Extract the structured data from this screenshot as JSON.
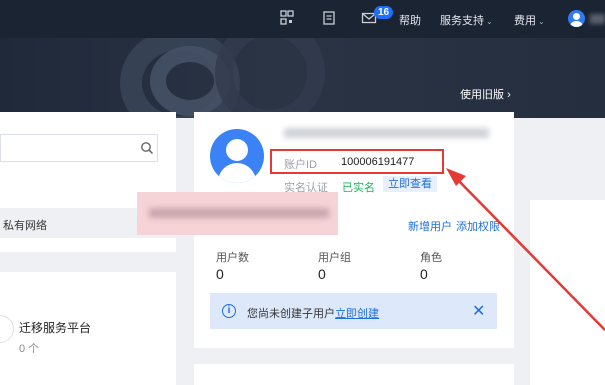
{
  "topbar": {
    "message_badge": "16",
    "help": "帮助",
    "service_support": "服务支持",
    "billing": "费用",
    "icons": [
      "qrcode-icon",
      "document-icon",
      "mail-icon",
      "user-avatar-icon"
    ]
  },
  "hero": {
    "old_version_link": "使用旧版"
  },
  "left_panel": {
    "network_item": "私有网络",
    "migration_title": "迁移服务平台",
    "migration_count": "0 个"
  },
  "account": {
    "id_label": "账户ID",
    "id_value": "100006191477",
    "verify_label": "实名认证",
    "verify_status": "已实名",
    "verify_button": "立即查看"
  },
  "user_management": {
    "add_user": "新增用户",
    "add_permission": "添加权限",
    "stats": [
      {
        "label": "用户数",
        "value": "0"
      },
      {
        "label": "用户组",
        "value": "0"
      },
      {
        "label": "角色",
        "value": "0"
      }
    ],
    "notice_text": "您尚未创建子用户",
    "notice_link": "立即创建"
  },
  "colors": {
    "topbar_bg": "#1b2433",
    "accent_blue": "#1e6fdb",
    "success_green": "#1bb55c",
    "annotation_red": "#e53935"
  }
}
